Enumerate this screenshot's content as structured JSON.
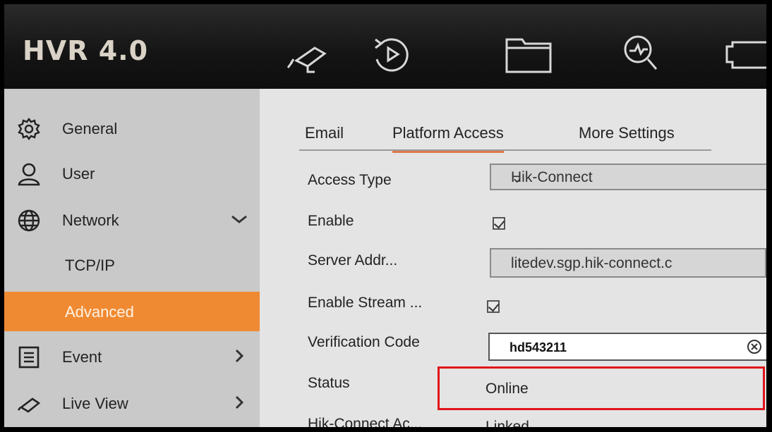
{
  "header": {
    "logo": "HVR 4.0",
    "nav_icons": [
      "camera-icon",
      "playback-icon",
      "folder-icon",
      "search-icon",
      "video-camera-icon"
    ]
  },
  "sidebar": {
    "items": [
      {
        "label": "General",
        "icon": "gear-icon"
      },
      {
        "label": "User",
        "icon": "user-icon"
      },
      {
        "label": "Network",
        "icon": "globe-icon",
        "expanded": true
      },
      {
        "label": "TCP/IP"
      },
      {
        "label": "Advanced",
        "active": true
      },
      {
        "label": "Event",
        "icon": "event-icon"
      },
      {
        "label": "Live View",
        "icon": "camera-icon"
      }
    ]
  },
  "tabs": [
    {
      "label": "Email"
    },
    {
      "label": "Platform Access",
      "active": true
    },
    {
      "label": "More Settings"
    }
  ],
  "form": {
    "access_type": {
      "label": "Access Type",
      "value": "Hik-Connect"
    },
    "enable": {
      "label": "Enable",
      "checked": true
    },
    "server_addr": {
      "label": "Server Addr...",
      "value": "litedev.sgp.hik-connect.c"
    },
    "enable_stream": {
      "label": "Enable Stream ...",
      "checked": true
    },
    "verification_code": {
      "label": "Verification Code",
      "value": "hd543211"
    },
    "status": {
      "label": "Status",
      "value": "Online"
    },
    "hik_connect_account": {
      "label": "Hik-Connect Ac...",
      "value": "Linked"
    }
  },
  "colors": {
    "accent": "#f08a32",
    "highlight_box": "#e0141a",
    "header_bg": "#1a1a1a"
  }
}
